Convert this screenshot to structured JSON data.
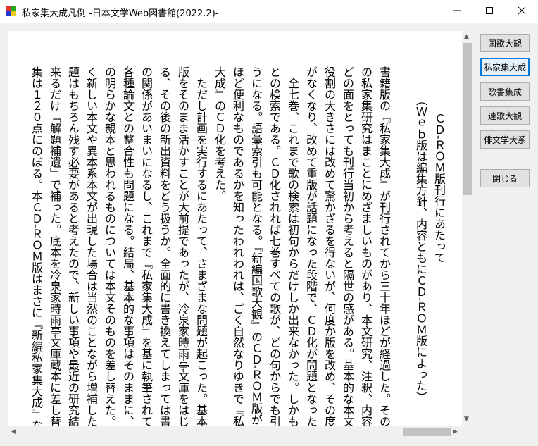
{
  "window": {
    "title": "私家集大成凡例 -日本文学Web図書館(2022.2)-"
  },
  "sidebar": {
    "buttons": [
      {
        "label": "国歌大観"
      },
      {
        "label": "私家集大成"
      },
      {
        "label": "歌書集成"
      },
      {
        "label": "連歌大観"
      },
      {
        "label": "俳文学大系"
      }
    ],
    "close_label": "閉じる"
  },
  "document": {
    "heading": "ＣＤ-ＲＯＭ版刊行にあたって",
    "subheading": "（Ｗｅｂ版は編集方針、内容ともにＣＤ-ＲＯＭ版によった）",
    "lines": [
      "書籍版の『私家集大成』が刊行されてから三十年ほどが経過した。その間",
      "の私家集研究はまことにめざましいものがあり、本文研究、注釈、内容研究、",
      "どの面をとっても刊行当初から考えると隔世の感がある。基本的な本文提供の",
      "役割の大きさには改めて驚かざるを得ないが、何度か版を改め、その度に在庫",
      "がなくなり、改めて重版が話題になった段階で、ＣＤ化が問題となった。",
      "全七巻、これまで歌の検索は初句からだけしか出来なかった。しかも各巻ご",
      "との検索である。ＣＤ化されれば七巻すべての歌が、どの句からでも引けるよ",
      "うになる。語彙索引も可能となる。『新編国歌大観』のＣＤ-ＲＯＭ版がどれ",
      "ほど便利なものであるかを知ったわれわれは、ごく自然なりゆきで『私家集",
      "大成』のＣＤ化を考えた。",
      "ただし計画を実行するにあたって、さまざまな問題が起こった。基本は書籍",
      "版をそのまま活かすことが大前提であったが、冷泉家時雨亭文庫をはじめとす",
      "る、その後の新出資料をどう扱うか。全面的に書き換えてしまっては書籍版と",
      "の関係があいまいになるし、これまで『私家集大成』を基に執筆されてきた",
      "各種論文との整合性も問題になる。結局、基本的な事項はそのままに、旧底本",
      "の明らかな親本と思われるものについては本文そのものを差し替えた。まった",
      "く新しい本文や異本系本文が出現した場合は当然のことながら増補した。旧解",
      "題はもちろん残す必要があると考えたので、新しい事項や最近の研究結果は出",
      "来るだけ「解題補遺」で補った。底本を冷泉家時雨亭文庫蔵本に差し替えた家",
      "集は１２０点にのぼる。本ＣＤ-ＲＯＭ版はまさに『新編私家集大成』なので"
    ]
  }
}
